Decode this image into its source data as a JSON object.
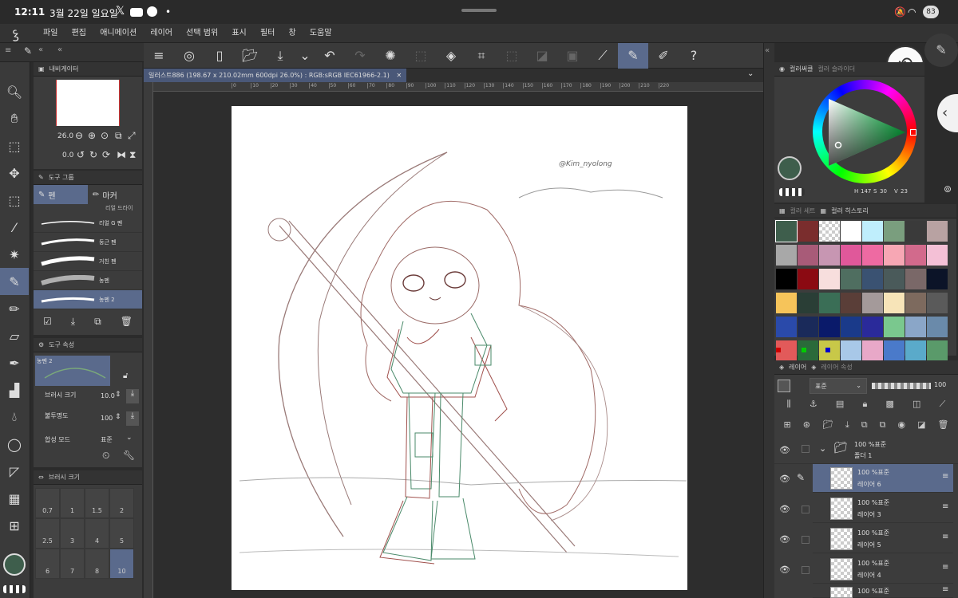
{
  "status": {
    "time": "12:11",
    "date": "3월 22일 일요일",
    "battery": "83"
  },
  "menu": [
    "파일",
    "편집",
    "애니메이션",
    "레이어",
    "선택 범위",
    "표시",
    "필터",
    "창",
    "도움말"
  ],
  "navigator": {
    "title": "내비게이터",
    "zoom": "26.0",
    "rotation": "0.0"
  },
  "subtool_group": {
    "title": "도구 그룹",
    "tabs": [
      "펜",
      "마커"
    ],
    "brushes": [
      "리얼 G 펜",
      "둥근 펜",
      "거친 펜",
      "농펜",
      "농펜 2"
    ],
    "partial_brush": "리얼 드라이"
  },
  "tool_property": {
    "title": "도구 속성",
    "brush_name": "농펜 2",
    "brush_size_label": "브러시 크기",
    "brush_size_value": "10.0",
    "opacity_label": "불투명도",
    "opacity_value": "100",
    "blend_label": "합성 모드",
    "blend_value": "표준"
  },
  "brush_size_panel": {
    "title": "브러시 크기",
    "sizes": [
      "0.7",
      "1",
      "1.5",
      "2",
      "2.5",
      "3",
      "4",
      "5",
      "6",
      "7",
      "8",
      "10"
    ],
    "selected": "10"
  },
  "document_tab": {
    "label": "일러스트886 (198.67 x 210.02mm 600dpi 26.0%) : RGB:sRGB IEC61966-2.1)"
  },
  "ruler_marks": [
    "0",
    "10",
    "20",
    "30",
    "40",
    "50",
    "60",
    "70",
    "80",
    "90",
    "100",
    "110",
    "120",
    "130",
    "140",
    "150",
    "160",
    "170",
    "180",
    "190",
    "200",
    "210",
    "220"
  ],
  "artwork": {
    "signature": "@Kim_nyolong"
  },
  "color_wheel": {
    "tabs": [
      "컬러써클",
      "컬러 슬라이더"
    ],
    "h": "147",
    "s": "30",
    "v": "23",
    "current_color": "#3e5e4c",
    "sub_color": "#111111"
  },
  "color_history": {
    "tabs": [
      "컬러 세트",
      "컬러 히스토리"
    ],
    "colors": [
      "#3e5e4c",
      "#7a2d2d",
      "checker",
      "#ffffff",
      "#bfeefc",
      "#7a9e7e",
      "#3a3a3a",
      "#b8a2a2",
      "#a8a8a8",
      "#a85b78",
      "#c796b2",
      "#e0589a",
      "#ee6aa2",
      "#f7a7b4",
      "#d26a8c",
      "#f4c0d6",
      "#000000",
      "#8b0a12",
      "#f7dedd",
      "#4f6e60",
      "#3a5272",
      "#4a5a5a",
      "#7a6868",
      "#0c1428",
      "#f6c45a",
      "#2a3e36",
      "#3a6e56",
      "#5a3e38",
      "#a49a9a",
      "#f7e4b8",
      "#7d6a5e",
      "#5a5a5a",
      "#2a4aaa",
      "#1a2a5a",
      "#0a1a6a",
      "#1a3a8a",
      "#2a2a9a",
      "#7ac88e",
      "#8aa6c8",
      "#6a8aaa",
      "#e25a5a",
      "#2a6a3a",
      "#c8c848",
      "#a8c8e8",
      "#e8a8c8",
      "#4a7aca",
      "#5aaaca",
      "#5a9a6a"
    ]
  },
  "layer_panel": {
    "tabs": [
      "레이어",
      "레이어 속성"
    ],
    "blend": "표준",
    "opacity": "100",
    "folder": {
      "title": "100 %표준",
      "name": "폴더 1"
    },
    "layers": [
      {
        "mode": "100 %표준",
        "name": "레이어 6"
      },
      {
        "mode": "100 %표준",
        "name": "레이어 3"
      },
      {
        "mode": "100 %표준",
        "name": "레이어 5"
      },
      {
        "mode": "100 %표준",
        "name": "레이어 4"
      },
      {
        "mode": "100 %표준",
        "name": ""
      }
    ]
  }
}
